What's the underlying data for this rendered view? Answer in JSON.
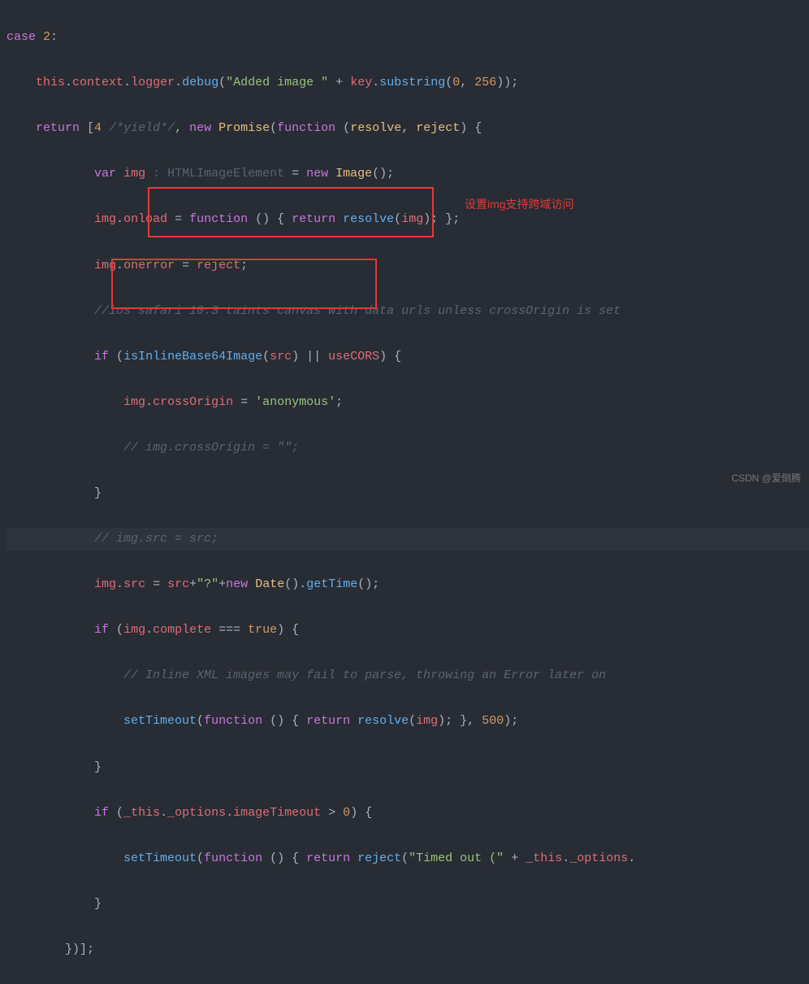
{
  "code": {
    "l1": {
      "case": "case",
      "num": "2",
      "colon": ":"
    },
    "l2": {
      "this": "this",
      "dot1": ".",
      "context": "context",
      "dot2": ".",
      "logger": "logger",
      "dot3": ".",
      "debug": "debug",
      "open": "(",
      "str": "\"Added image \"",
      "plus": " + ",
      "key": "key",
      "dot4": ".",
      "substring": "substring",
      "open2": "(",
      "zero": "0",
      "comma": ", ",
      "n256": "256",
      "close": "));"
    },
    "l3": {
      "return": "return",
      "open": " [",
      "four": "4",
      "yield": " /*yield*/",
      "comma": ", ",
      "new": "new",
      "sp": " ",
      "Promise": "Promise",
      "open2": "(",
      "function": "function",
      "sp2": " (",
      "resolve": "resolve",
      "comma2": ", ",
      "reject": "reject",
      "close": ") {"
    },
    "l4": {
      "var": "var",
      "sp": " ",
      "img": "img",
      "typeann": " : HTMLImageElement",
      "eq": " = ",
      "new": "new",
      "sp2": " ",
      "Image": "Image",
      "close": "();"
    },
    "l5": {
      "img": "img",
      "dot": ".",
      "onload": "onload",
      "eq": " = ",
      "function": "function",
      "par": " () { ",
      "return": "return",
      "sp": " ",
      "resolve": "resolve",
      "open": "(",
      "img2": "img",
      "close": "); };"
    },
    "l6": {
      "img": "img",
      "dot": ".",
      "onerror": "onerror",
      "eq": " = ",
      "reject": "reject",
      "semi": ";"
    },
    "l7": {
      "cm": "//ios safari 10.3 taints canvas with data urls unless crossOrigin is set"
    },
    "l8": {
      "if": "if",
      "open": " (",
      "isInlineBase64Image": "isInlineBase64Image",
      "open2": "(",
      "src": "src",
      "close": ") || ",
      "useCORS": "useCORS",
      "close2": ") {"
    },
    "l9": {
      "img": "img",
      "dot": ".",
      "crossOrigin": "crossOrigin",
      "eq": " = ",
      "str": "'anonymous'",
      "semi": ";"
    },
    "l10": {
      "cm": "// img.crossOrigin = \"\";"
    },
    "l11": {
      "brace": "}"
    },
    "l12": {
      "cm": "// img.src = src;"
    },
    "l13": {
      "img": "img",
      "dot": ".",
      "src": "src",
      "eq": " = ",
      "srcvar": "src",
      "plus": "+",
      "q": "\"?\"",
      "plus2": "+",
      "new": "new",
      "sp": " ",
      "Date": "Date",
      "par": "().",
      "getTime": "getTime",
      "close": "();"
    },
    "l14": {
      "if": "if",
      "open": " (",
      "img": "img",
      "dot": ".",
      "complete": "complete",
      "eqeq": " === ",
      "true": "true",
      "close": ") {"
    },
    "l15": {
      "cm": "// Inline XML images may fail to parse, throwing an Error later on"
    },
    "l16": {
      "setTimeout": "setTimeout",
      "open": "(",
      "function": "function",
      "par": " () { ",
      "return": "return",
      "sp": " ",
      "resolve": "resolve",
      "open2": "(",
      "img": "img",
      "close": "); }, ",
      "n500": "500",
      "close2": ");"
    },
    "l17": {
      "brace": "}"
    },
    "l18": {
      "if": "if",
      "open": " (",
      "_this": "_this",
      "dot": ".",
      "_options": "_options",
      "dot2": ".",
      "imageTimeout": "imageTimeout",
      "gt": " > ",
      "zero": "0",
      "close": ") {"
    },
    "l19": {
      "setTimeout": "setTimeout",
      "open": "(",
      "function": "function",
      "par": " () { ",
      "return": "return",
      "sp": " ",
      "reject": "reject",
      "open2": "(",
      "str": "\"Timed out (\"",
      "plus": " + ",
      "_this": "_this",
      "dot": ".",
      "_options": "_options",
      "dot2": "."
    },
    "l20": {
      "brace": "}"
    },
    "l21": {
      "close": "})];"
    }
  },
  "annotation1": "设置img支持跨域访问",
  "watermark": "CSDN @爱倒腾"
}
